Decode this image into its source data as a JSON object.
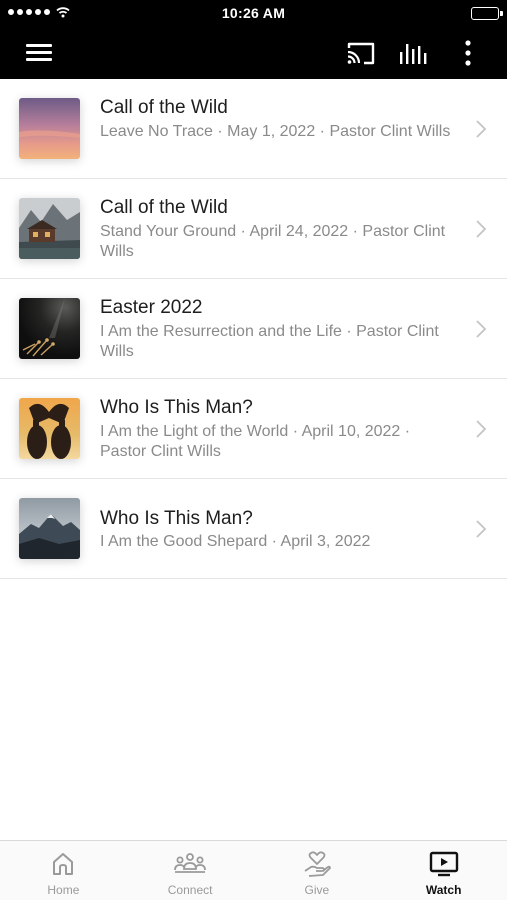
{
  "status_bar": {
    "time": "10:26 AM"
  },
  "header": {
    "menu_icon": "hamburger-icon",
    "cast_icon": "cast-icon",
    "audio_icon": "audio-bars-icon",
    "more_icon": "more-vertical-icon"
  },
  "sermons": [
    {
      "title": "Call of the Wild",
      "subtitle": "Leave No Trace · May 1, 2022 · Pastor Clint Wills",
      "thumb": "sunset-sky"
    },
    {
      "title": "Call of the Wild",
      "subtitle": "Stand Your Ground · April 24, 2022 · Pastor Clint Wills",
      "thumb": "mountain-cabin"
    },
    {
      "title": "Easter 2022",
      "subtitle": "I Am the Resurrection and the Life · Pastor Clint Wills",
      "thumb": "dark-wheat"
    },
    {
      "title": "Who Is This Man?",
      "subtitle": "I Am the Light of the World · April 10, 2022 · Pastor Clint Wills",
      "thumb": "heart-hands"
    },
    {
      "title": "Who Is This Man?",
      "subtitle": "I Am the Good Shepard · April 3, 2022",
      "thumb": "mountain-range"
    }
  ],
  "tabs": [
    {
      "label": "Home",
      "icon": "home-icon",
      "active": false
    },
    {
      "label": "Connect",
      "icon": "people-icon",
      "active": false
    },
    {
      "label": "Give",
      "icon": "give-hand-icon",
      "active": false
    },
    {
      "label": "Watch",
      "icon": "tv-play-icon",
      "active": true
    }
  ],
  "colors": {
    "header_bg": "#000000",
    "active_tab": "#111111",
    "inactive_tab": "#9a9a9a",
    "subtitle": "#8a8a8a"
  }
}
